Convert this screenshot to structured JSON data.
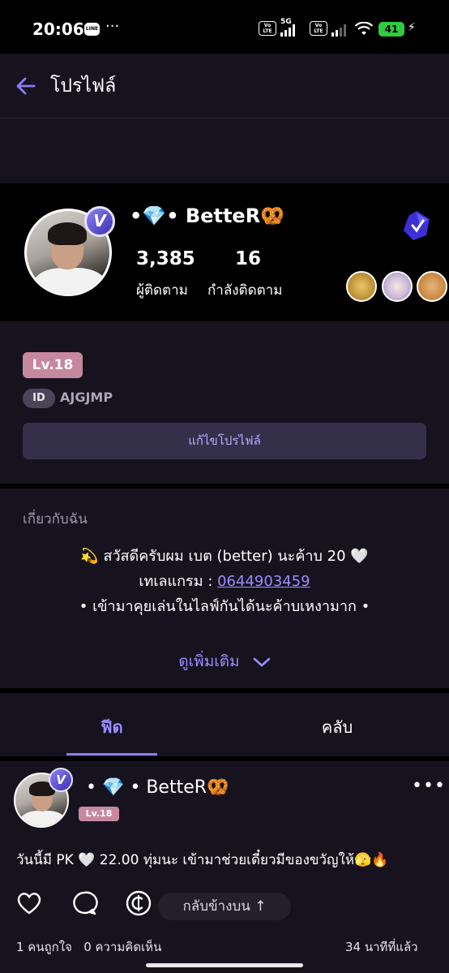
{
  "status_bar": {
    "time": "20:06",
    "line_label": "LINE",
    "more": "···",
    "volte1": "Vo LTE",
    "gen1": "5G",
    "volte2": "Vo LTE",
    "battery": "41"
  },
  "header": {
    "title": "โปรไฟล์"
  },
  "profile": {
    "display_name": "•💎• BetteR🥨",
    "followers_count": "3,385",
    "followers_label": "ผู้ติดตาม",
    "following_count": "16",
    "following_label": "กำลังติดตาม",
    "verified_badge": "V"
  },
  "level": {
    "badge": "Lv.18",
    "id_label": "ID",
    "id_value": "AJGJMP",
    "edit_button": "แก้ไขโปรไฟล์"
  },
  "about": {
    "title": "เกี่ยวกับฉัน",
    "line1": "💫 สวัสดีครับผม เบต (better) นะค้าบ 20 🤍",
    "line2_prefix": "เทเลแกรม : ",
    "line2_link": "0644903459",
    "line3": "• เข้ามาคุยเล่นในไลฟ์กันได้นะค้าบเหงามาก •",
    "see_more": "ดูเพิ่มเติม"
  },
  "tabs": {
    "feed": "ฟีด",
    "club": "คลับ",
    "active": "feed"
  },
  "post": {
    "author": "• 💎 •  BetteR🥨",
    "level": "Lv.18",
    "verified_badge": "V",
    "more": "•••",
    "text": "วันนี้มี PK 🤍 22.00 ทุ่มนะ เข้ามาช่วยเดี๋ยวมีของขวัญให้🫣🔥",
    "scroll_top_label": "กลับข้างบน ↑",
    "likes_text": "1 คนถูกใจ",
    "comments_text": "0 ความคิดเห็น",
    "time_ago": "34 นาทีที่แล้ว"
  },
  "colors": {
    "accent": "#9b8cff",
    "background": "#16131f",
    "level_badge": "#c7889f",
    "battery": "#2ecc40"
  }
}
